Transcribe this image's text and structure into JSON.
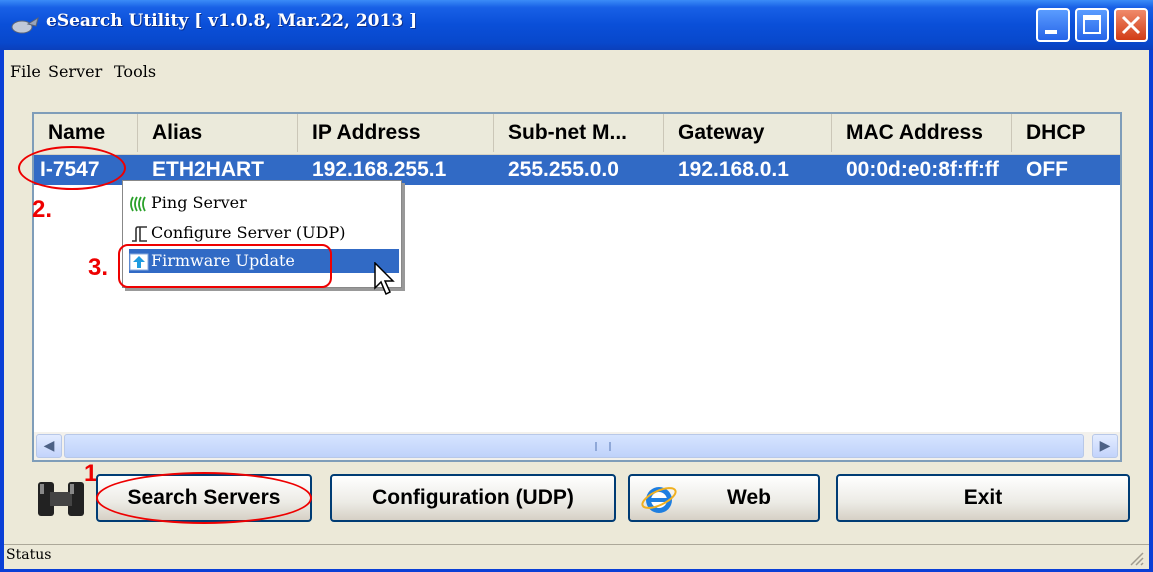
{
  "window": {
    "title": "eSearch Utility [ v1.0.8, Mar.22, 2013 ]",
    "accent": "#0a4fd8",
    "close_color": "#d23c16"
  },
  "menu": {
    "items": [
      {
        "label": "File"
      },
      {
        "label": "Server"
      },
      {
        "label": "Tools"
      }
    ]
  },
  "table": {
    "columns": [
      "Name",
      "Alias",
      "IP Address",
      "Sub-net M...",
      "Gateway",
      "MAC Address",
      "DHCP"
    ],
    "rows": [
      {
        "name": "I-7547",
        "alias": "ETH2HART",
        "ip": "192.168.255.1",
        "subnet": "255.255.0.0",
        "gateway": "192.168.0.1",
        "mac": "00:0d:e0:8f:ff:ff",
        "dhcp": "OFF"
      }
    ],
    "selected_color": "#316ac5"
  },
  "context_menu": {
    "items": [
      {
        "label": "Ping Server",
        "icon": "signal-waves-icon"
      },
      {
        "label": "Configure Server (UDP)",
        "icon": "configure-icon"
      },
      {
        "label": "Firmware Update",
        "icon": "upload-arrow-icon",
        "selected": true
      }
    ]
  },
  "annotations": {
    "step1": "1.",
    "step2": "2.",
    "step3": "3.",
    "color": "#e00000"
  },
  "buttons": {
    "search": "Search Servers",
    "configuration": "Configuration (UDP)",
    "web": "Web",
    "exit": "Exit"
  },
  "status": {
    "text": "Status"
  }
}
